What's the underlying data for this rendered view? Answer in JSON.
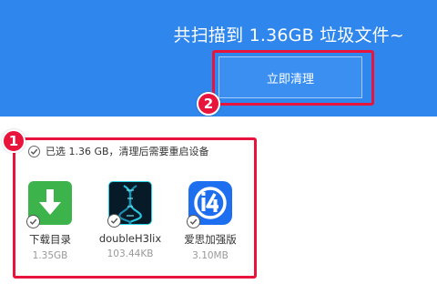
{
  "header": {
    "summary_text": "共扫描到 1.36GB 垃圾文件~",
    "clean_button_label": "立即清理",
    "background_color": "#2f86ec"
  },
  "annotations": {
    "badge_1": "1",
    "badge_2": "2",
    "highlight_color": "#e8143c"
  },
  "selection": {
    "summary_text": "已选 1.36 GB，清理后需要重启设备"
  },
  "apps": [
    {
      "name": "下载目录",
      "size": "1.35GB",
      "icon": "download-arrow-icon",
      "color": "#3cb44b"
    },
    {
      "name": "doubleH3lix",
      "size": "103.44KB",
      "icon": "dna-helix-icon",
      "color": "#071a28"
    },
    {
      "name": "爱思加强版",
      "size": "3.10MB",
      "icon": "i4-logo-icon",
      "color": "#1e6ff0"
    }
  ]
}
